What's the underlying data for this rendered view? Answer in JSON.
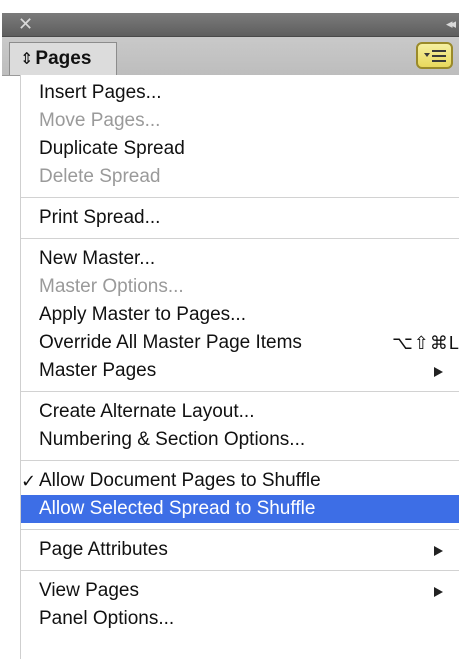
{
  "panel": {
    "close_glyph": "✕",
    "collapse_glyph": "◂◂",
    "tab_arrows": "⇕",
    "tab_label": "Pages"
  },
  "menu": {
    "groups": [
      [
        {
          "label": "Insert Pages...",
          "enabled": true
        },
        {
          "label": "Move Pages...",
          "enabled": false
        },
        {
          "label": "Duplicate Spread",
          "enabled": true
        },
        {
          "label": "Delete Spread",
          "enabled": false
        }
      ],
      [
        {
          "label": "Print Spread...",
          "enabled": true
        }
      ],
      [
        {
          "label": "New Master...",
          "enabled": true
        },
        {
          "label": "Master Options...",
          "enabled": false
        },
        {
          "label": "Apply Master to Pages...",
          "enabled": true
        },
        {
          "label": "Override All Master Page Items",
          "enabled": true,
          "shortcut": "⌥⇧⌘L"
        },
        {
          "label": "Master Pages",
          "enabled": true,
          "submenu": true
        }
      ],
      [
        {
          "label": "Create Alternate Layout...",
          "enabled": true
        },
        {
          "label": "Numbering & Section Options...",
          "enabled": true
        }
      ],
      [
        {
          "label": "Allow Document Pages to Shuffle",
          "enabled": true,
          "checked": true
        },
        {
          "label": "Allow Selected Spread to Shuffle",
          "enabled": true,
          "selected": true
        }
      ],
      [
        {
          "label": "Page Attributes",
          "enabled": true,
          "submenu": true
        }
      ],
      [
        {
          "label": "View Pages",
          "enabled": true,
          "submenu": true
        },
        {
          "label": "Panel Options...",
          "enabled": true
        }
      ]
    ]
  },
  "colors": {
    "highlight": "#3d6ee6",
    "disabled_text": "#9a9a9a",
    "menu_button_fill": "#e8d85c"
  }
}
